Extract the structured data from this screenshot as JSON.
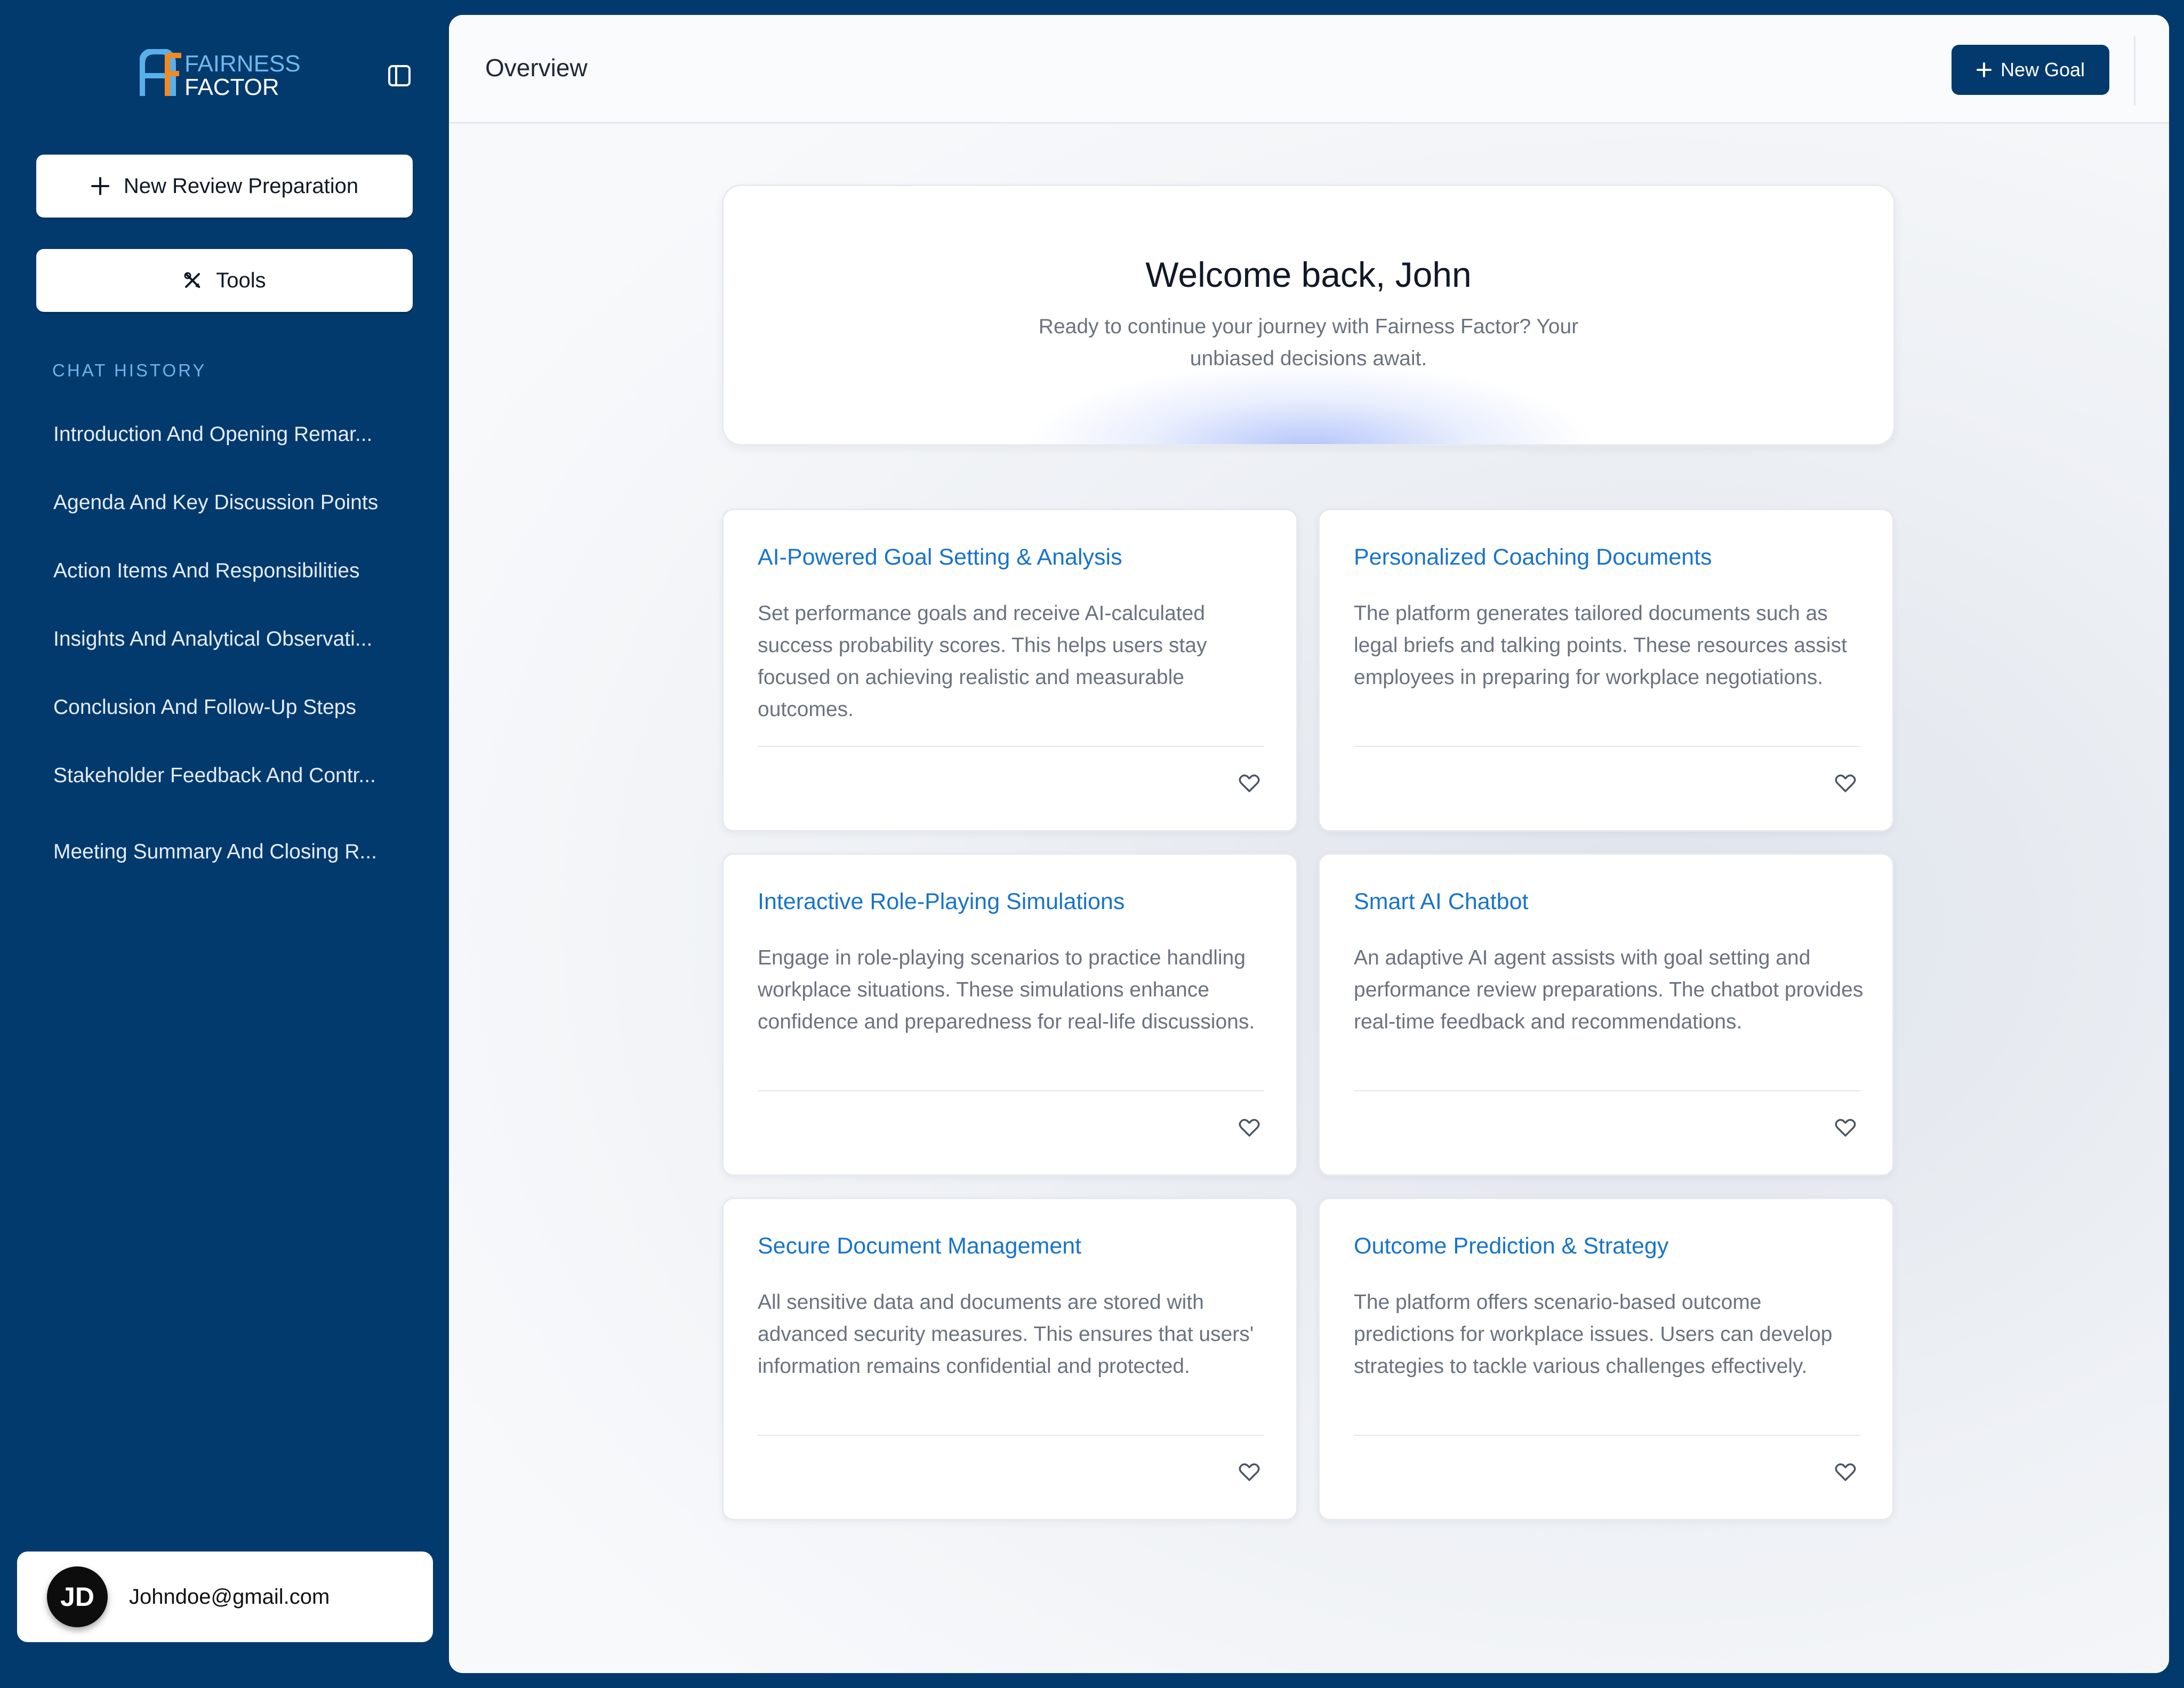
{
  "brand": {
    "line1": "FAIRNESS",
    "line2": "FACTOR",
    "accent_color": "#f08a24",
    "primary_color": "#033a6e",
    "link_color": "#1874c9"
  },
  "sidebar": {
    "toggle_icon": "sidebar-panel-icon",
    "new_review_label": "New Review Preparation",
    "tools_label": "Tools",
    "chat_history_heading": "CHAT HISTORY",
    "history": [
      "Introduction And Opening Remar...",
      "Agenda And Key Discussion Points",
      "Action Items And Responsibilities",
      "Insights And Analytical Observati...",
      "Conclusion And Follow-Up Steps",
      "Stakeholder Feedback And Contr...",
      "Meeting Summary And Closing R..."
    ],
    "user": {
      "initials": "JD",
      "email": "Johndoe@gmail.com"
    }
  },
  "header": {
    "title": "Overview",
    "new_goal_label": "New Goal"
  },
  "welcome": {
    "title": "Welcome back, John",
    "subtitle": "Ready to continue your journey with Fairness Factor? Your unbiased decisions await."
  },
  "cards": [
    {
      "title": "AI-Powered Goal Setting & Analysis",
      "description": "Set performance goals and receive AI-calculated success probability scores. This helps users stay focused on achieving realistic and measurable outcomes."
    },
    {
      "title": "Personalized Coaching Documents",
      "description": "The platform generates tailored documents such as legal briefs and talking points. These resources assist employees in preparing for workplace negotiations."
    },
    {
      "title": "Interactive Role-Playing Simulations",
      "description": "Engage in role-playing scenarios to practice handling workplace situations. These simulations enhance confidence and preparedness for real-life discussions."
    },
    {
      "title": "Smart AI Chatbot",
      "description": "An adaptive AI agent assists with goal setting and performance review preparations. The chatbot provides real-time feedback and recommendations."
    },
    {
      "title": "Secure Document Management",
      "description": "All sensitive data and documents are stored with advanced security measures. This ensures that users' information remains confidential and protected."
    },
    {
      "title": "Outcome Prediction & Strategy",
      "description": "The platform offers scenario-based outcome predictions for workplace issues. Users can develop strategies to tackle various challenges effectively."
    }
  ]
}
